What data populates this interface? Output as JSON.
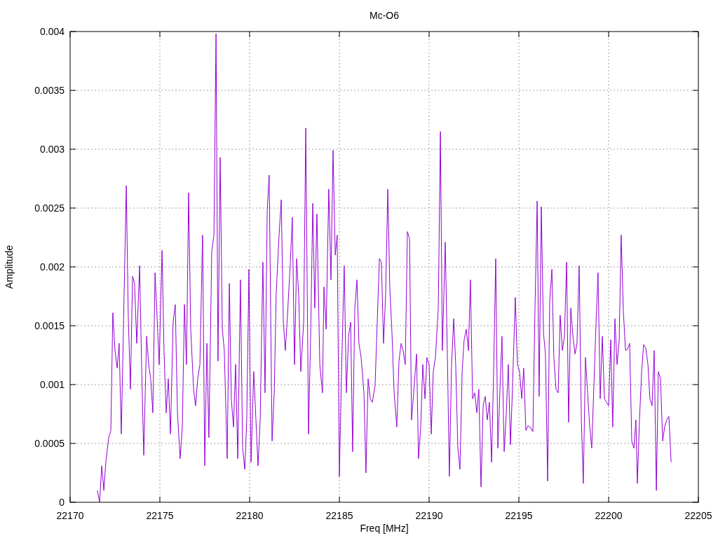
{
  "chart": {
    "chart_data": {
      "type": "line",
      "title": "Mc-O6",
      "xlabel": "Freq [MHz]",
      "ylabel": "Amplitude",
      "x": [
        22171.52,
        22171.64,
        22171.76,
        22171.88,
        22171.99,
        22172.15,
        22172.27,
        22172.38,
        22172.5,
        22172.62,
        22172.73,
        22172.85,
        22172.97,
        22173.13,
        22173.24,
        22173.36,
        22173.48,
        22173.59,
        22173.71,
        22173.87,
        22173.98,
        22174.1,
        22174.26,
        22174.38,
        22174.49,
        22174.61,
        22174.73,
        22174.84,
        22174.96,
        22175.12,
        22175.23,
        22175.35,
        22175.47,
        22175.59,
        22175.74,
        22175.86,
        22175.98,
        22176.13,
        22176.25,
        22176.37,
        22176.48,
        22176.6,
        22176.72,
        22176.88,
        22176.99,
        22177.11,
        22177.23,
        22177.38,
        22177.5,
        22177.62,
        22177.73,
        22177.89,
        22178.01,
        22178.13,
        22178.24,
        22178.36,
        22178.48,
        22178.59,
        22178.75,
        22178.87,
        22178.98,
        22179.1,
        22179.22,
        22179.34,
        22179.49,
        22179.61,
        22179.73,
        22179.84,
        22179.96,
        22180.08,
        22180.23,
        22180.35,
        22180.47,
        22180.59,
        22180.74,
        22180.86,
        22180.98,
        22181.09,
        22181.25,
        22181.37,
        22181.48,
        22181.64,
        22181.76,
        22181.88,
        22181.99,
        22182.11,
        22182.27,
        22182.38,
        22182.5,
        22182.62,
        22182.73,
        22182.85,
        22183.01,
        22183.13,
        22183.28,
        22183.4,
        22183.52,
        22183.63,
        22183.75,
        22183.91,
        22184.06,
        22184.14,
        22184.26,
        22184.41,
        22184.53,
        22184.65,
        22184.77,
        22184.88,
        22185,
        22185.12,
        22185.27,
        22185.39,
        22185.51,
        22185.63,
        22185.74,
        22185.86,
        22185.98,
        22186.09,
        22186.21,
        22186.37,
        22186.48,
        22186.6,
        22186.72,
        22186.84,
        22186.99,
        22187.11,
        22187.23,
        22187.34,
        22187.46,
        22187.58,
        22187.7,
        22187.81,
        22187.93,
        22188.05,
        22188.2,
        22188.32,
        22188.44,
        22188.55,
        22188.67,
        22188.79,
        22188.91,
        22189.02,
        22189.14,
        22189.3,
        22189.41,
        22189.53,
        22189.65,
        22189.77,
        22189.88,
        22190,
        22190.12,
        22190.23,
        22190.35,
        22190.51,
        22190.63,
        22190.74,
        22190.9,
        22191.02,
        22191.13,
        22191.25,
        22191.37,
        22191.48,
        22191.6,
        22191.72,
        22191.84,
        22191.95,
        22192.07,
        22192.19,
        22192.3,
        22192.42,
        22192.54,
        22192.66,
        22192.77,
        22192.89,
        22193.01,
        22193.13,
        22193.24,
        22193.36,
        22193.48,
        22193.59,
        22193.71,
        22193.83,
        22193.95,
        22194.06,
        22194.18,
        22194.3,
        22194.41,
        22194.53,
        22194.65,
        22194.8,
        22194.92,
        22195.04,
        22195.16,
        22195.27,
        22195.39,
        22195.51,
        22195.63,
        22195.78,
        22195.9,
        22196.02,
        22196.13,
        22196.25,
        22196.37,
        22196.48,
        22196.6,
        22196.72,
        22196.84,
        22196.95,
        22197.07,
        22197.19,
        22197.3,
        22197.42,
        22197.54,
        22197.66,
        22197.77,
        22197.89,
        22198.01,
        22198.13,
        22198.24,
        22198.36,
        22198.48,
        22198.59,
        22198.71,
        22198.83,
        22198.95,
        22199.06,
        22199.18,
        22199.3,
        22199.41,
        22199.53,
        22199.65,
        22199.77,
        22199.88,
        22200,
        22200.12,
        22200.23,
        22200.35,
        22200.47,
        22200.59,
        22200.7,
        22200.82,
        22200.94,
        22201.05,
        22201.17,
        22201.29,
        22201.41,
        22201.52,
        22201.6,
        22201.72,
        22201.84,
        22201.95,
        22202.07,
        22202.19,
        22202.3,
        22202.42,
        22202.54,
        22202.66,
        22202.77,
        22202.89,
        22203.01,
        22203.12,
        22203.24,
        22203.36,
        22203.48
      ],
      "series": [
        {
          "color": "#9400d3",
          "values": [
            0.0001,
            0,
            0.00031,
            0.0001,
            0.00034,
            0.00055,
            0.00061,
            0.00161,
            0.00129,
            0.00114,
            0.00135,
            0.00058,
            0.00147,
            0.00269,
            0.00159,
            0.00096,
            0.00192,
            0.00186,
            0.00135,
            0.00201,
            0.00117,
            0.0004,
            0.00141,
            0.00117,
            0.00105,
            0.00076,
            0.00195,
            0.00159,
            0.00117,
            0.00214,
            0.00129,
            0.00076,
            0.00105,
            0.00058,
            0.00153,
            0.00168,
            0.00076,
            0.00037,
            0.00064,
            0.00168,
            0.00117,
            0.00263,
            0.00147,
            0.00096,
            0.00082,
            0.00105,
            0.00117,
            0.00227,
            0.00031,
            0.00135,
            0.00055,
            0.00213,
            0.00227,
            0.00398,
            0.0012,
            0.00293,
            0.00147,
            0.00129,
            0.00037,
            0.00186,
            0.00088,
            0.00064,
            0.00117,
            0.00037,
            0.00189,
            0.00046,
            0.00028,
            0.0007,
            0.00198,
            0.00034,
            0.00111,
            0.0007,
            0.00031,
            0.0007,
            0.00204,
            0.00093,
            0.00248,
            0.00278,
            0.00052,
            0.00093,
            0.00177,
            0.00227,
            0.00257,
            0.00153,
            0.00129,
            0.00159,
            0.00204,
            0.00242,
            0.00117,
            0.00207,
            0.00177,
            0.00111,
            0.00153,
            0.00318,
            0.00058,
            0.00141,
            0.00254,
            0.00165,
            0.00245,
            0.00117,
            0.00093,
            0.00183,
            0.00147,
            0.00266,
            0.00189,
            0.00299,
            0.0021,
            0.00227,
            0.00022,
            0.00111,
            0.00201,
            0.00093,
            0.00141,
            0.00153,
            0.00043,
            0.00165,
            0.00189,
            0.00135,
            0.00123,
            0.00093,
            0.00025,
            0.00105,
            0.00088,
            0.00085,
            0.00099,
            0.00153,
            0.00207,
            0.00204,
            0.00135,
            0.00177,
            0.00266,
            0.00183,
            0.00144,
            0.00093,
            0.00064,
            0.0012,
            0.00135,
            0.00129,
            0.00117,
            0.0023,
            0.00224,
            0.0007,
            0.00093,
            0.00126,
            0.00037,
            0.00064,
            0.00117,
            0.00088,
            0.00123,
            0.00117,
            0.00058,
            0.00111,
            0.00123,
            0.00165,
            0.00315,
            0.00129,
            0.00221,
            0.00123,
            0.00022,
            0.00117,
            0.00156,
            0.00117,
            0.00046,
            0.00028,
            0.00111,
            0.00138,
            0.00147,
            0.00129,
            0.00189,
            0.00088,
            0.00093,
            0.00076,
            0.00096,
            0.00013,
            0.00082,
            0.0009,
            0.0007,
            0.00085,
            0.00034,
            0.00108,
            0.00207,
            0.00046,
            0.00096,
            0.00141,
            0.00043,
            0.00076,
            0.00117,
            0.00049,
            0.00099,
            0.00174,
            0.00117,
            0.00111,
            0.00088,
            0.00114,
            0.00061,
            0.00065,
            0.00064,
            0.0006,
            0.00165,
            0.00256,
            0.0009,
            0.00251,
            0.00144,
            0.00126,
            0.00018,
            0.00171,
            0.00198,
            0.00123,
            0.00096,
            0.00093,
            0.00159,
            0.00129,
            0.00141,
            0.00204,
            0.00068,
            0.00165,
            0.00141,
            0.00126,
            0.00135,
            0.00201,
            0.0007,
            0.00016,
            0.00123,
            0.00093,
            0.00064,
            0.00046,
            0.00099,
            0.00153,
            0.00195,
            0.00088,
            0.00141,
            0.00088,
            0.00085,
            0.00082,
            0.00138,
            0.00064,
            0.00156,
            0.00117,
            0.00138,
            0.00227,
            0.00162,
            0.00129,
            0.0013,
            0.00135,
            0.00052,
            0.00046,
            0.0007,
            0.00016,
            0.0007,
            0.00111,
            0.00134,
            0.00131,
            0.00117,
            0.00088,
            0.00082,
            0.00129,
            0.0001,
            0.00111,
            0.00105,
            0.00052,
            0.00064,
            0.0007,
            0.00073,
            0.00034
          ]
        }
      ],
      "grid": true,
      "xlim": [
        22170,
        22205
      ],
      "ylim": [
        0,
        0.004
      ],
      "xticks": [
        22170,
        22175,
        22180,
        22185,
        22190,
        22195,
        22200,
        22205
      ],
      "yticks": [
        0,
        0.0005,
        0.001,
        0.0015,
        0.002,
        0.0025,
        0.003,
        0.0035,
        0.004
      ]
    }
  }
}
